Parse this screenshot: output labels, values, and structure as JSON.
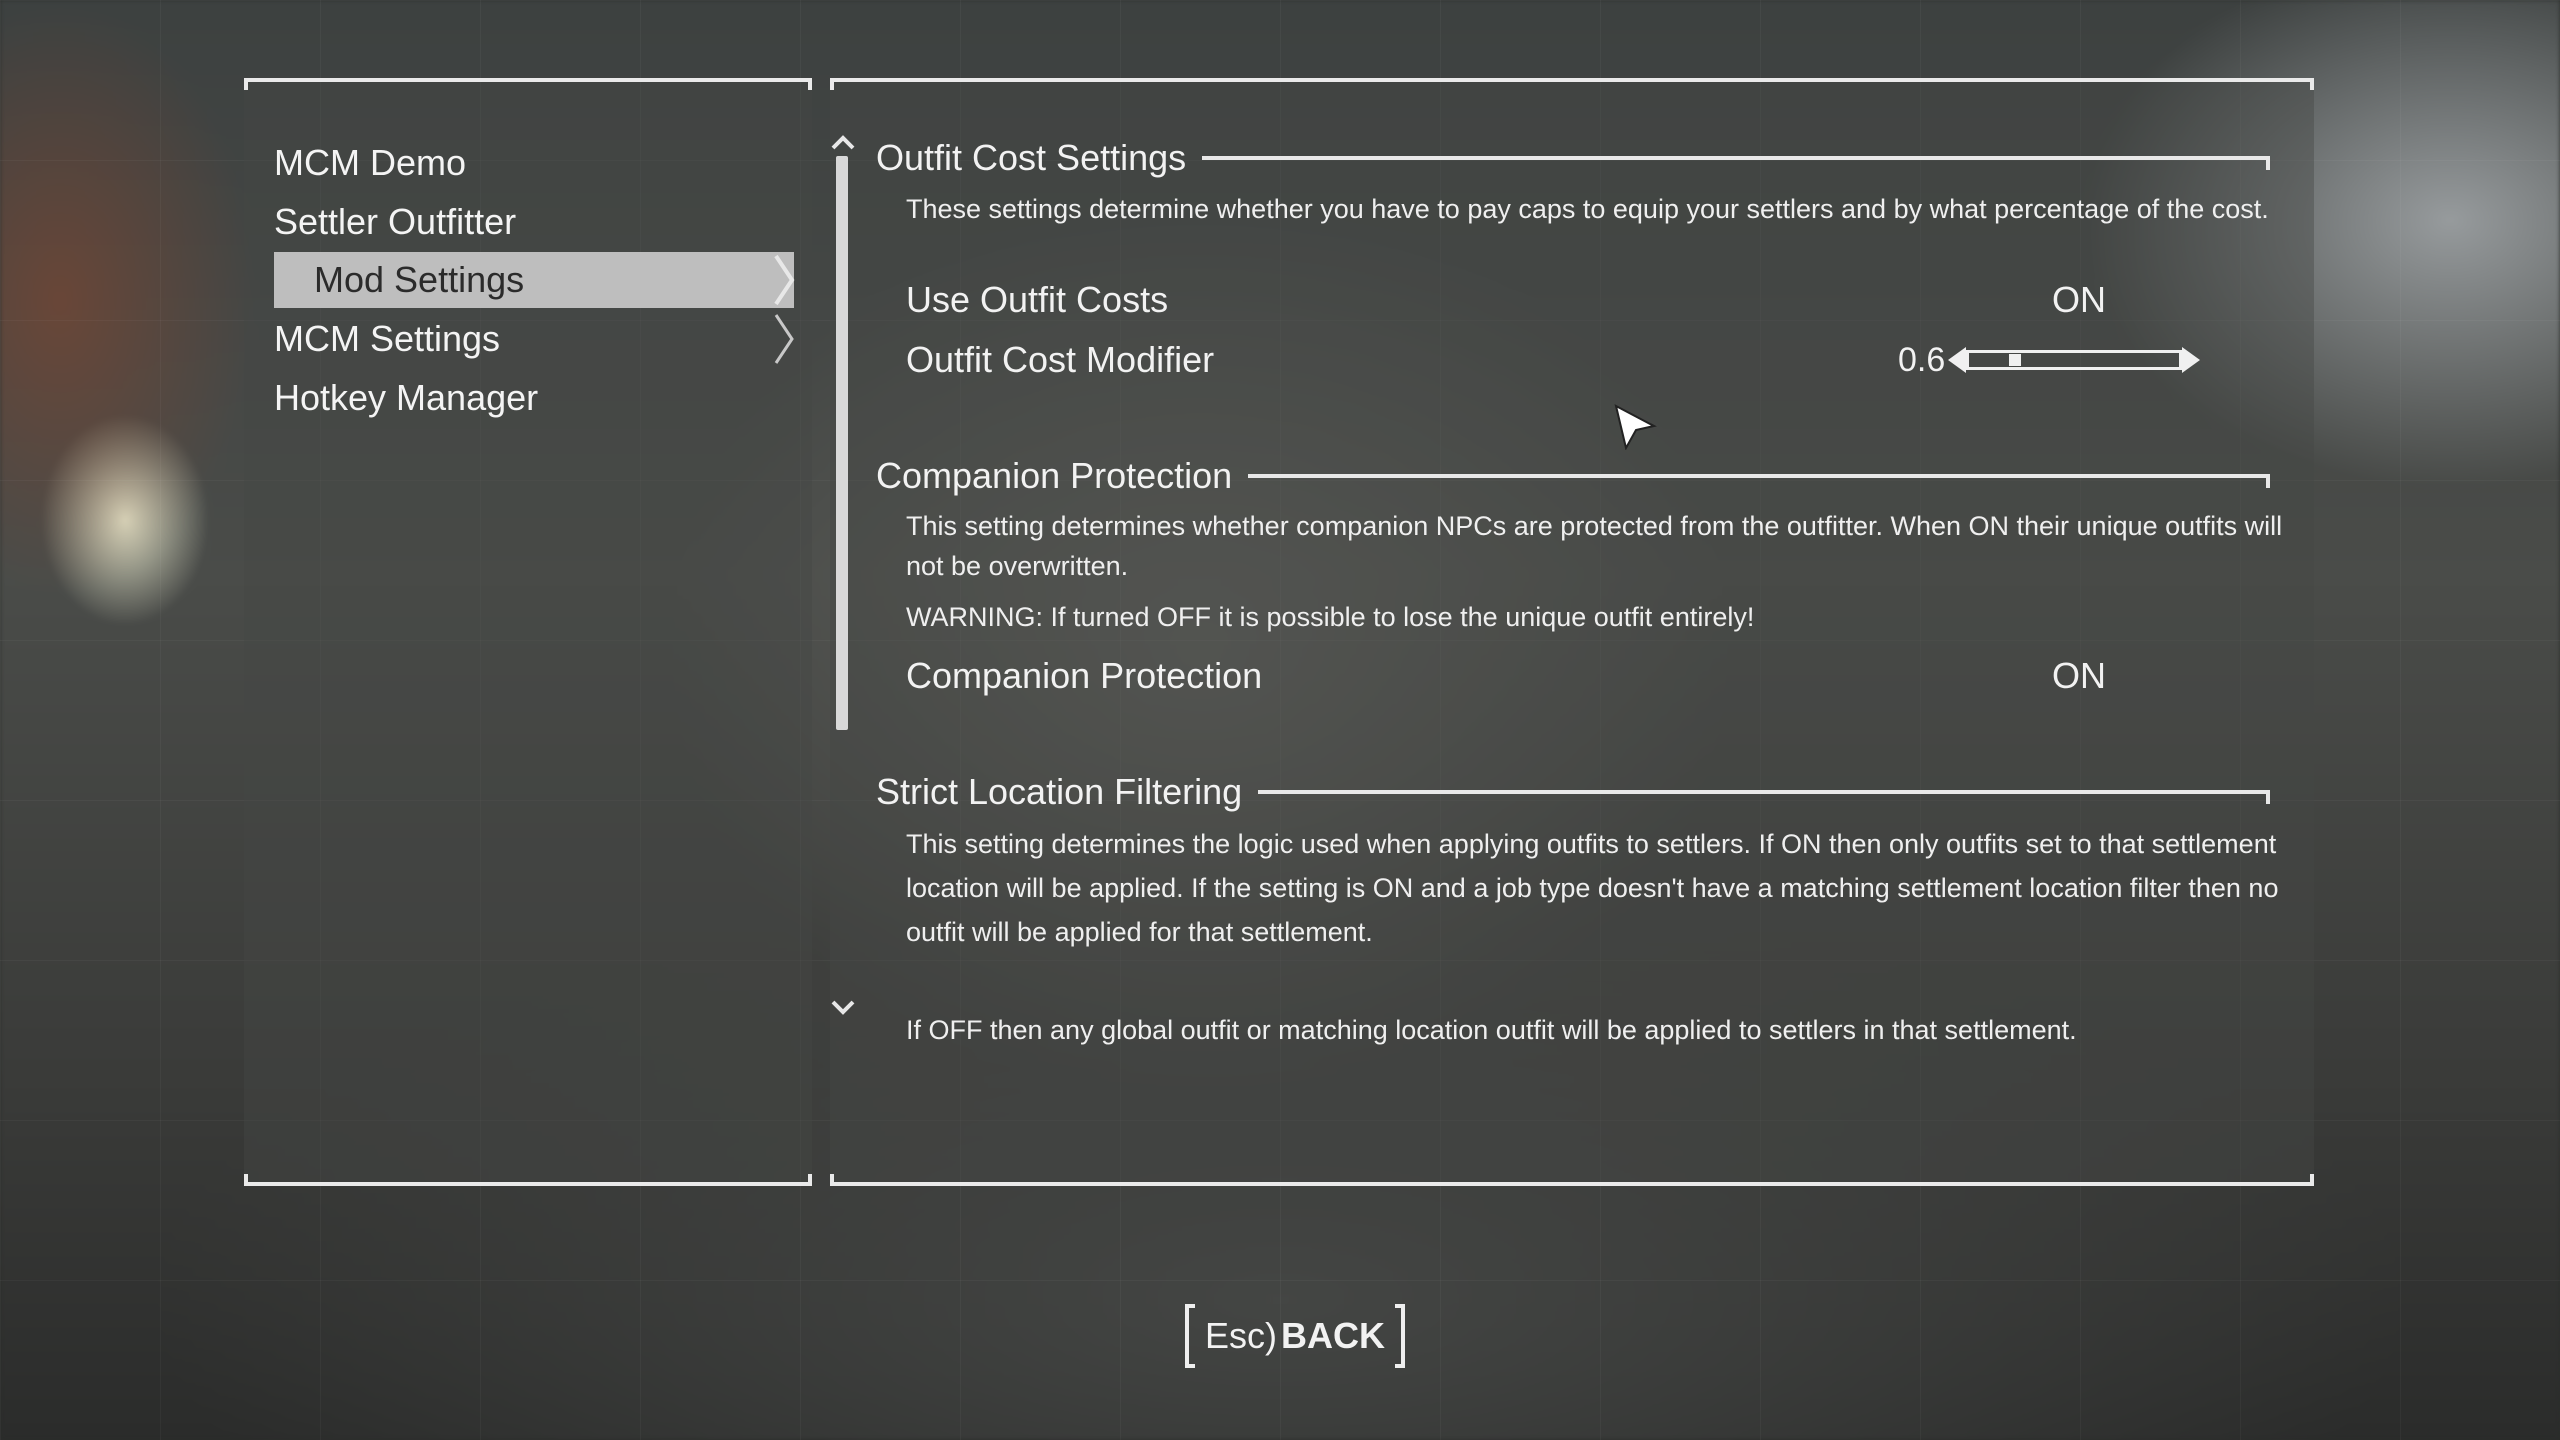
{
  "menu": {
    "items": [
      {
        "label": "MCM Demo"
      },
      {
        "label": "Settler Outfitter"
      },
      {
        "label": "Mod Settings"
      },
      {
        "label": "MCM Settings"
      },
      {
        "label": "Hotkey Manager"
      }
    ],
    "selected_index": 2
  },
  "sections": [
    {
      "title": "Outfit Cost Settings",
      "description": "These settings determine whether you have to pay caps to equip your settlers and by what percentage of the cost."
    },
    {
      "title": "Companion Protection",
      "description": "This setting determines whether companion NPCs are protected from the outfitter. When ON their unique outfits will not be overwritten.",
      "warning": "WARNING: If turned OFF it is possible to lose the unique outfit entirely!"
    },
    {
      "title": "Strict Location Filtering",
      "description": "This setting determines the logic used when applying outfits to settlers. If ON then only outfits set to that settlement location will be applied. If the setting is ON and a job type doesn't have a matching settlement location filter then no outfit will be applied for that settlement.",
      "description2": "If OFF then any global outfit or matching location outfit will be applied to settlers in that settlement."
    }
  ],
  "settings": {
    "use_outfit_costs": {
      "label": "Use Outfit Costs",
      "value": "ON"
    },
    "outfit_cost_modifier": {
      "label": "Outfit Cost Modifier",
      "value": "0.6",
      "level": 0.2
    },
    "companion_protection": {
      "label": "Companion Protection",
      "value": "ON"
    }
  },
  "footer": {
    "back_key": "Esc)",
    "back_label": "BACK"
  },
  "colors": {
    "frame": "#eaeaea",
    "selected_bg": "#bebebe",
    "selected_text": "#2b2b2b"
  }
}
